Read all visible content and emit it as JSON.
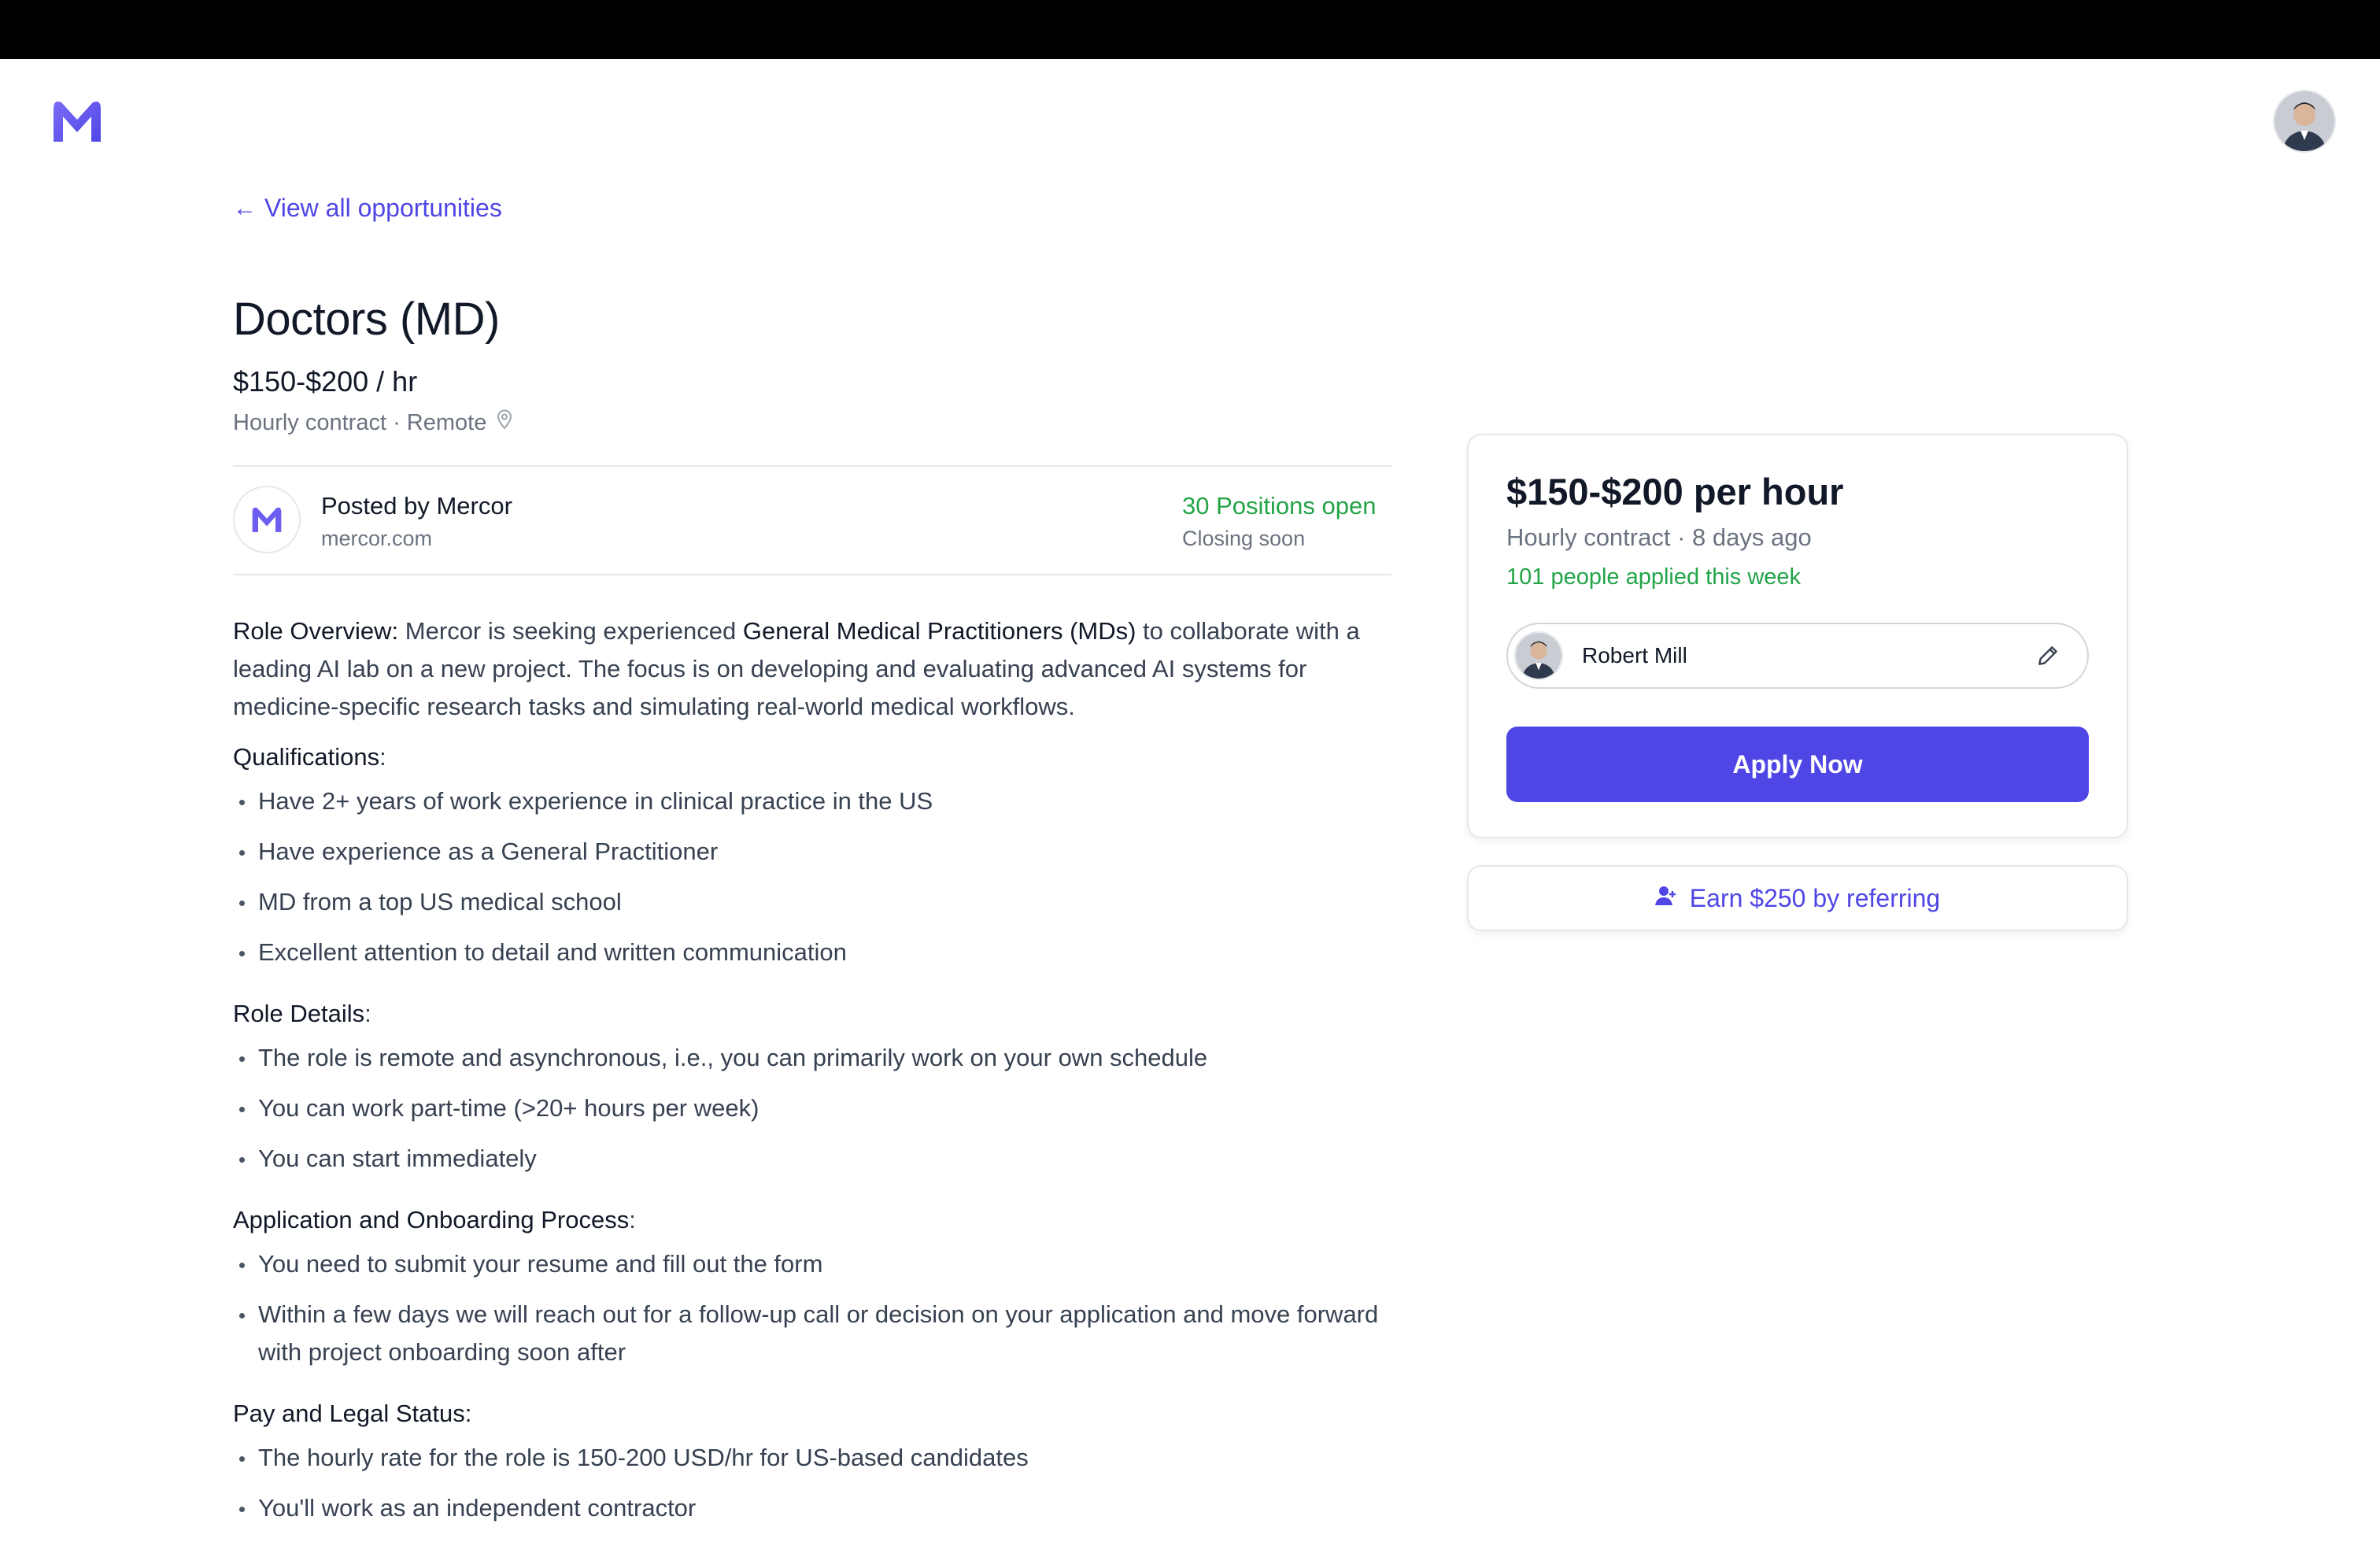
{
  "colors": {
    "accent": "#4f46e5",
    "success": "#22a447",
    "muted": "#6b7280",
    "text": "#111827"
  },
  "header": {
    "logo_icon": "mercor-m-logo",
    "avatar_icon": "user-avatar"
  },
  "back_link": {
    "arrow": "←",
    "label": "View all opportunities"
  },
  "job": {
    "title": "Doctors (MD)",
    "rate": "$150-$200 / hr",
    "contract": "Hourly contract · Remote",
    "location_icon": "map-pin-icon"
  },
  "poster": {
    "name": "Posted by Mercor",
    "domain": "mercor.com",
    "positions": "30 Positions open",
    "closing": "Closing soon"
  },
  "description": {
    "overview_label": "Role Overview:",
    "overview_pre": " Mercor is seeking experienced ",
    "overview_strong": "General Medical Practitioners (MDs)",
    "overview_post": " to collaborate with a leading AI lab on a new project. The focus is on developing and evaluating advanced AI systems for medicine-specific research tasks and simulating real-world medical workflows.",
    "sections": [
      {
        "heading": "Qualifications",
        "colon": ":",
        "items": [
          "Have 2+ years of work experience in clinical practice in the US",
          "Have experience as a General Practitioner",
          "MD from a top US medical school",
          "Excellent attention to detail and written communication"
        ]
      },
      {
        "heading": "Role Details",
        "colon": ":",
        "items": [
          "The role is remote and asynchronous, i.e., you can primarily work on your own schedule",
          "You can work part-time (>20+ hours per week)",
          "You can start immediately"
        ]
      },
      {
        "heading": "Application and Onboarding Process",
        "colon": ":",
        "items": [
          "You need to submit your resume and fill out the form",
          "Within a few days we will reach out for a follow-up call or decision on your application and move forward with project onboarding soon after"
        ]
      },
      {
        "heading": "Pay and Legal Status:",
        "colon": "",
        "items": [
          "The hourly rate for the role is 150-200 USD/hr for US-based candidates",
          "You'll work as an independent contractor"
        ]
      }
    ]
  },
  "apply_card": {
    "price": "$150-$200 per hour",
    "meta": "Hourly contract · 8 days ago",
    "applied": "101 people applied this week",
    "user_name": "Robert Mill",
    "edit_icon": "pencil-icon",
    "apply_label": "Apply Now"
  },
  "referral": {
    "icon": "user-plus-icon",
    "label": "Earn $250 by referring"
  }
}
